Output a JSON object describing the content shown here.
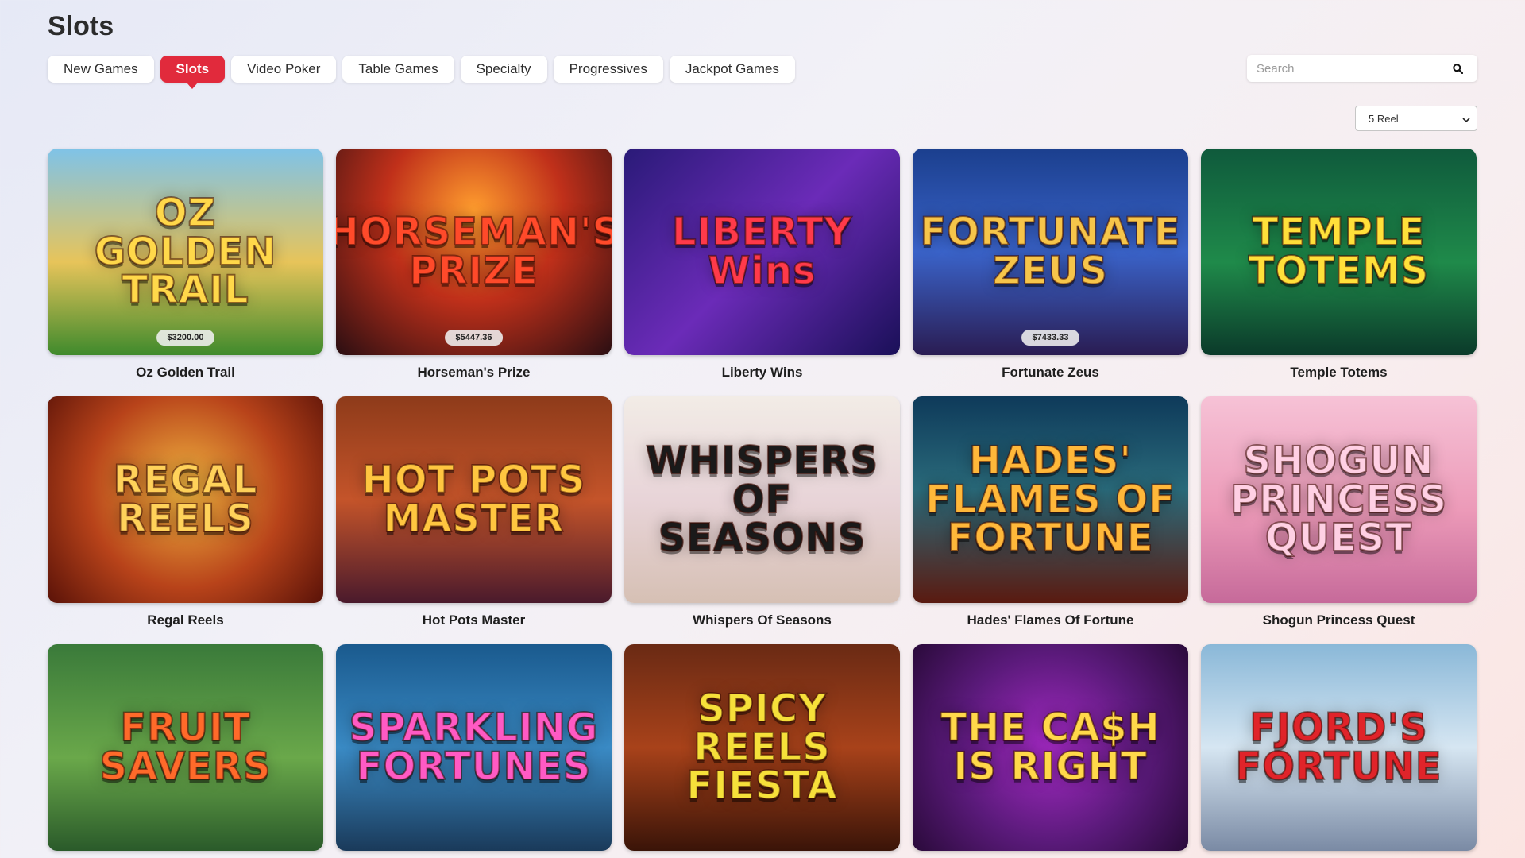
{
  "header": {
    "title": "Slots"
  },
  "tabs": [
    {
      "label": "New Games",
      "active": false
    },
    {
      "label": "Slots",
      "active": true
    },
    {
      "label": "Video Poker",
      "active": false
    },
    {
      "label": "Table Games",
      "active": false
    },
    {
      "label": "Specialty",
      "active": false
    },
    {
      "label": "Progressives",
      "active": false
    },
    {
      "label": "Jackpot Games",
      "active": false
    }
  ],
  "search": {
    "placeholder": "Search",
    "icon": "search-icon"
  },
  "filter": {
    "selected": "5 Reel",
    "icon": "chevron-down-icon"
  },
  "colors": {
    "accent": "#e12a3c"
  },
  "games": [
    {
      "name": "Oz Golden Trail",
      "art": "OZ GOLDEN TRAIL",
      "jackpot": "$3200.00",
      "bg": "linear-gradient(180deg,#7fc3e8 0%,#e7c45a 55%,#3f8a2c 100%)",
      "fg": "#ffd84a"
    },
    {
      "name": "Horseman's Prize",
      "art": "HORSEMAN'S PRIZE",
      "jackpot": "$5447.36",
      "bg": "radial-gradient(circle at 50% 30%,#ff9d2e 0%,#c0301a 45%,#2a0e12 100%)",
      "fg": "#ff4a2a"
    },
    {
      "name": "Liberty Wins",
      "art": "LIBERTY Wins",
      "jackpot": "",
      "bg": "linear-gradient(135deg,#2a1a78 0%,#6b2bb8 50%,#1a1058 100%)",
      "fg": "#ff3a4a"
    },
    {
      "name": "Fortunate Zeus",
      "art": "FORTUNATE ZEUS",
      "jackpot": "$7433.33",
      "bg": "linear-gradient(180deg,#1b3f8e 0%,#3a63c9 50%,#2a1c52 100%)",
      "fg": "#f6c54a"
    },
    {
      "name": "Temple Totems",
      "art": "TEMPLE TOTEMS",
      "jackpot": "",
      "bg": "linear-gradient(180deg,#0f5a3c 0%,#1f8a4a 55%,#0b3a2a 100%)",
      "fg": "#ffe03a"
    },
    {
      "name": "Regal Reels",
      "art": "REGAL REELS",
      "jackpot": "",
      "bg": "radial-gradient(circle at 50% 45%,#f2b640 0%,#b8431a 55%,#5a1208 100%)",
      "fg": "#ffd25a"
    },
    {
      "name": "Hot Pots Master",
      "art": "HOT POTS MASTER",
      "jackpot": "",
      "bg": "linear-gradient(180deg,#8e3b1a 0%,#c4542a 50%,#4a1a2c 100%)",
      "fg": "#ffc640"
    },
    {
      "name": "Whispers Of Seasons",
      "art": "WHISPERS OF SEASONS",
      "jackpot": "",
      "bg": "linear-gradient(180deg,#f2ece6 0%,#e8d4d8 50%,#d6c0b4 100%)",
      "fg": "#1a1a1a"
    },
    {
      "name": "Hades' Flames Of Fortune",
      "art": "HADES' FLAMES OF FORTUNE",
      "jackpot": "",
      "bg": "linear-gradient(180deg,#0e3a5a 0%,#2a6a7a 45%,#5a1a10 100%)",
      "fg": "#ffb83a"
    },
    {
      "name": "Shogun Princess Quest",
      "art": "SHOGUN PRINCESS QUEST",
      "jackpot": "",
      "bg": "linear-gradient(180deg,#f6c2d6 0%,#ec9ab8 55%,#c66a9a 100%)",
      "fg": "#ffd0e4"
    },
    {
      "name": "Fruit Savers",
      "art": "FRUIT SAVERS",
      "jackpot": "",
      "bg": "linear-gradient(180deg,#3a7a3a 0%,#6aa84a 55%,#2a5a2a 100%)",
      "fg": "#ff6a2a"
    },
    {
      "name": "Sparkling Fortunes",
      "art": "SPARKLING FORTUNES",
      "jackpot": "",
      "bg": "linear-gradient(180deg,#1a5a8e 0%,#3a8ac4 50%,#1a3a5a 100%)",
      "fg": "#ff5ac4"
    },
    {
      "name": "Spicy Reels Fiesta",
      "art": "SPICY REELS FIESTA",
      "jackpot": "",
      "bg": "linear-gradient(180deg,#6a2a14 0%,#a8421a 50%,#3a1408 100%)",
      "fg": "#f6e03a"
    },
    {
      "name": "The Cash Is Right",
      "art": "THE CA$H IS RIGHT",
      "jackpot": "",
      "bg": "radial-gradient(circle at 50% 50%,#a42ac4 0%,#5a1a7a 55%,#2a0a3a 100%)",
      "fg": "#ffd84a"
    },
    {
      "name": "Fjord's Fortune",
      "art": "FJORD'S FORTUNE",
      "jackpot": "",
      "bg": "linear-gradient(180deg,#8ab8d8 0%,#d6e6f2 50%,#7a8aa4 100%)",
      "fg": "#e0242a"
    }
  ]
}
